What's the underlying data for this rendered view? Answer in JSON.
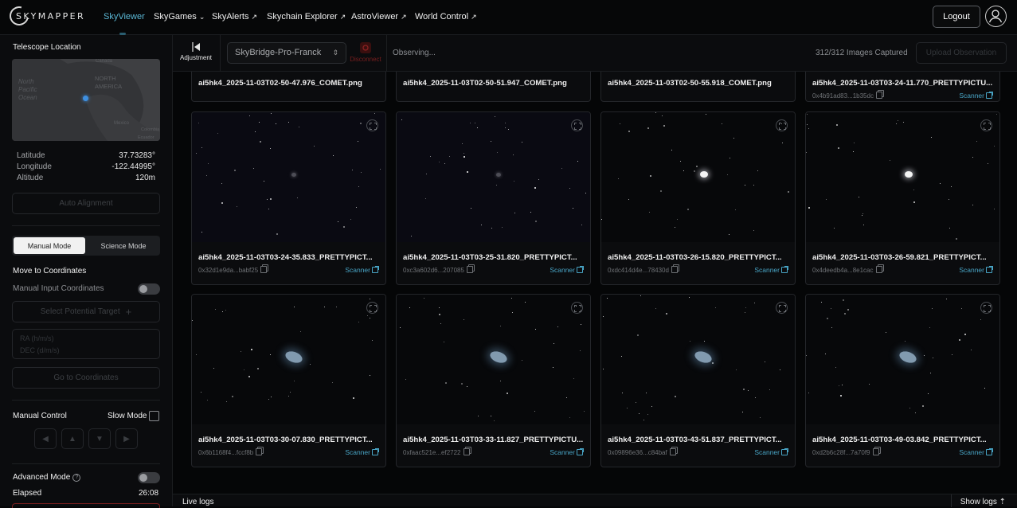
{
  "brand": {
    "logo_text": "SKYMAPPER"
  },
  "nav": [
    {
      "label": "SkyViewer",
      "suffix": "",
      "active": true
    },
    {
      "label": "SkyGames",
      "suffix": "⌄",
      "active": false
    },
    {
      "label": "SkyAlerts",
      "suffix": "↗",
      "active": false
    },
    {
      "label": "Skychain Explorer",
      "suffix": "↗",
      "active": false
    },
    {
      "label": "AstroViewer",
      "suffix": "↗",
      "active": false
    },
    {
      "label": "World Control",
      "suffix": "↗",
      "active": false
    }
  ],
  "header": {
    "logout_label": "Logout",
    "avatar_icon": "user-icon"
  },
  "sidebar": {
    "telescope_location_title": "Telescope Location",
    "map": {
      "ocean": "North Pacific Ocean",
      "continent": "NORTH AMERICA",
      "labels": [
        "Canada",
        "Mexico",
        "Ecuador",
        "Colombia"
      ]
    },
    "latitude_label": "Latitude",
    "latitude_value": "37.73283°",
    "longitude_label": "Longitude",
    "longitude_value": "-122.44995°",
    "altitude_label": "Altitude",
    "altitude_value": "120m",
    "auto_alignment_label": "Auto Alignment",
    "mode_manual": "Manual Mode",
    "mode_science": "Science Mode",
    "move_to_coordinates_title": "Move to Coordinates",
    "manual_input_label": "Manual Input Coordinates",
    "select_target_label": "Select Potential Target",
    "ra_placeholder": "RA (h/m/s)",
    "dec_placeholder": "DEC (d/m/s)",
    "go_to_coordinates_label": "Go to Coordinates",
    "manual_control_title": "Manual Control",
    "slow_mode_label": "Slow Mode",
    "dpad": [
      "◀",
      "▲",
      "▼",
      "▶"
    ],
    "advanced_mode_label": "Advanced Mode",
    "elapsed_label": "Elapsed",
    "elapsed_value": "26:08"
  },
  "toolbar": {
    "adjustment_label": "Adjustment",
    "telescope_select_value": "SkyBridge-Pro-Franck",
    "disconnect_label": "Disconnect",
    "status_text": "Observing...",
    "images_captured": "312/312 Images Captured",
    "upload_label": "Upload Observation"
  },
  "cards": [
    {
      "filename": "ai5hk4_2025-11-03T02-50-47.976_COMET.png",
      "hash": "",
      "scanner": ""
    },
    {
      "filename": "ai5hk4_2025-11-03T02-50-51.947_COMET.png",
      "hash": "",
      "scanner": ""
    },
    {
      "filename": "ai5hk4_2025-11-03T02-50-55.918_COMET.png",
      "hash": "",
      "scanner": ""
    },
    {
      "filename": "ai5hk4_2025-11-03T03-24-11.770_PRETTYPICTU...",
      "hash": "0x4b91ad83...1b35dc",
      "scanner": "Scanner"
    },
    {
      "filename": "ai5hk4_2025-11-03T03-24-35.833_PRETTYPICT...",
      "hash": "0x32d1e9da...babf25",
      "scanner": "Scanner"
    },
    {
      "filename": "ai5hk4_2025-11-03T03-25-31.820_PRETTYPICT...",
      "hash": "0xc3a602d6...207085",
      "scanner": "Scanner"
    },
    {
      "filename": "ai5hk4_2025-11-03T03-26-15.820_PRETTYPICT...",
      "hash": "0xdc414d4e...78430d",
      "scanner": "Scanner"
    },
    {
      "filename": "ai5hk4_2025-11-03T03-26-59.821_PRETTYPICT...",
      "hash": "0x4deedb4a...8e1cac",
      "scanner": "Scanner"
    },
    {
      "filename": "ai5hk4_2025-11-03T03-30-07.830_PRETTYPICT...",
      "hash": "0x6b1168f4...fccf8b",
      "scanner": "Scanner"
    },
    {
      "filename": "ai5hk4_2025-11-03T03-33-11.827_PRETTYPICTU...",
      "hash": "0xfaac521e...ef2722",
      "scanner": "Scanner"
    },
    {
      "filename": "ai5hk4_2025-11-03T03-43-51.837_PRETTYPICT...",
      "hash": "0x09896e36...c84baf",
      "scanner": "Scanner"
    },
    {
      "filename": "ai5hk4_2025-11-03T03-49-03.842_PRETTYPICT...",
      "hash": "0xd2b6c28f...7a70f9",
      "scanner": "Scanner"
    }
  ],
  "footer": {
    "live_logs_label": "Live logs",
    "show_logs_label": "Show logs",
    "show_logs_icon": "chevron-up-icon"
  }
}
